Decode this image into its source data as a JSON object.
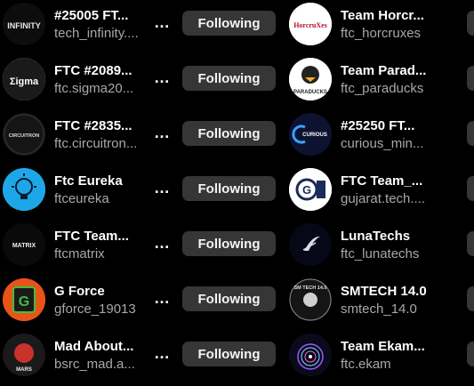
{
  "following_label": "Following",
  "more_icon": "…",
  "left": [
    {
      "name": "#25005 FT...",
      "handle": "tech_infinity....",
      "avatar_text": "INFINITY"
    },
    {
      "name": "FTC #2089...",
      "handle": "ftc.sigma20...",
      "avatar_text": "Σigma"
    },
    {
      "name": "FTC #2835...",
      "handle": "ftc.circuitron...",
      "avatar_text": "CIRCUITRON"
    },
    {
      "name": "Ftc Eureka",
      "handle": "ftceureka",
      "avatar_text": ""
    },
    {
      "name": "FTC Team...",
      "handle": "ftcmatrix",
      "avatar_text": "MATRIX"
    },
    {
      "name": "G Force",
      "handle": "gforce_19013",
      "avatar_text": "G"
    },
    {
      "name": "Mad About...",
      "handle": "bsrc_mad.a...",
      "avatar_text": "MARS"
    }
  ],
  "right": [
    {
      "name": "Team Horcr...",
      "handle": "ftc_horcruxes",
      "avatar_text": "HorcruXes"
    },
    {
      "name": "Team Parad...",
      "handle": "ftc_paraducks",
      "avatar_text": "PARADUCKS"
    },
    {
      "name": "#25250 FT...",
      "handle": "curious_min...",
      "avatar_text": "CURIOUS"
    },
    {
      "name": "FTC Team_...",
      "handle": "gujarat.tech....",
      "avatar_text": "G"
    },
    {
      "name": "LunaTechs",
      "handle": "ftc_lunatechs",
      "avatar_text": ""
    },
    {
      "name": "SMTECH 14.0",
      "handle": "smtech_14.0",
      "avatar_text": "SM TECH 14.0"
    },
    {
      "name": "Team Ekam...",
      "handle": "ftc.ekam",
      "avatar_text": ""
    }
  ]
}
